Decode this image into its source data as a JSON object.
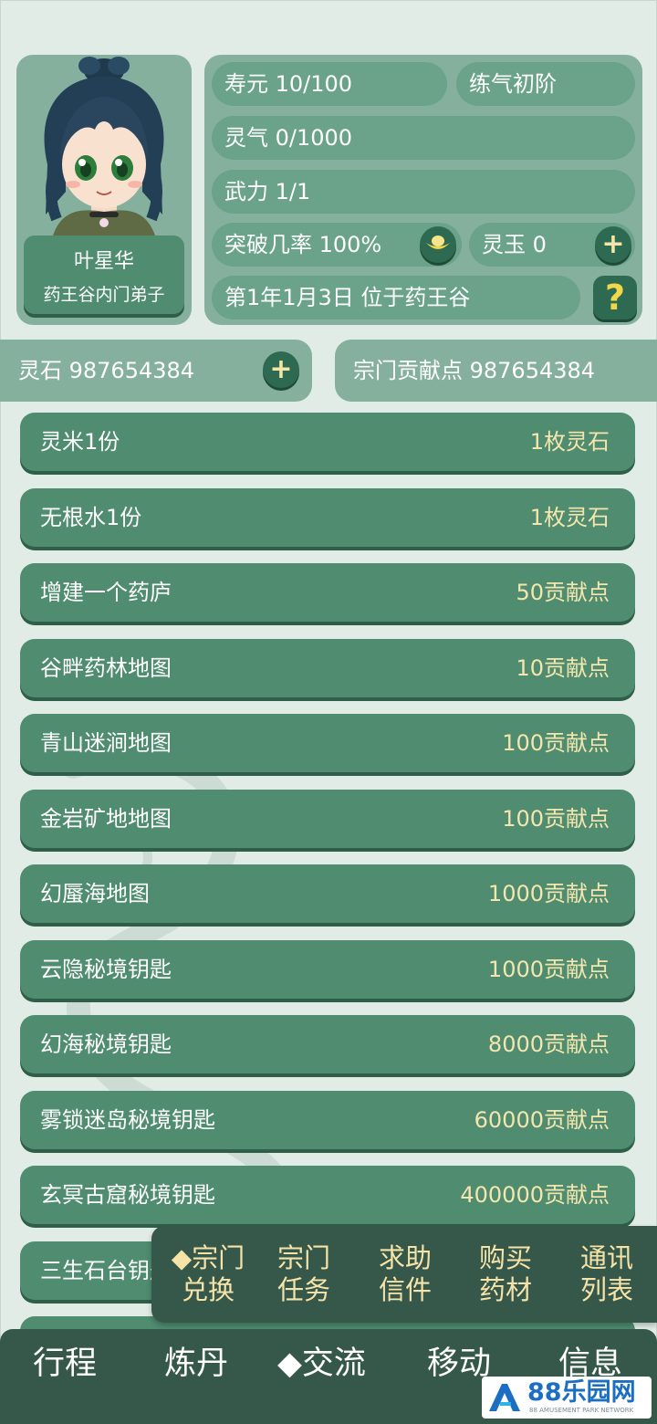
{
  "character": {
    "name": "叶星华",
    "title": "药王谷内门弟子"
  },
  "stats": {
    "lifespan": "寿元 10/100",
    "realm": "练气初阶",
    "spirit_qi": "灵气 0/1000",
    "force": "武力 1/1",
    "breakthrough": "突破几率 100%",
    "spirit_jade": "灵玉 0",
    "date_location": "第1年1月3日 位于药王谷"
  },
  "currency": {
    "spirit_stone": "灵石 987654384",
    "sect_contribution": "宗门贡献点 987654384"
  },
  "items": [
    {
      "label": "灵米1份",
      "price": "1枚灵石"
    },
    {
      "label": "无根水1份",
      "price": "1枚灵石"
    },
    {
      "label": "增建一个药庐",
      "price": "50贡献点"
    },
    {
      "label": "谷畔药林地图",
      "price": "10贡献点"
    },
    {
      "label": "青山迷涧地图",
      "price": "100贡献点"
    },
    {
      "label": "金岩矿地地图",
      "price": "100贡献点"
    },
    {
      "label": "幻蜃海地图",
      "price": "1000贡献点"
    },
    {
      "label": "云隐秘境钥匙",
      "price": "1000贡献点"
    },
    {
      "label": "幻海秘境钥匙",
      "price": "8000贡献点"
    },
    {
      "label": "雾锁迷岛秘境钥匙",
      "price": "60000贡献点"
    },
    {
      "label": "玄冥古窟秘境钥匙",
      "price": "400000贡献点"
    },
    {
      "label": "三生石台钥匙",
      "price": ""
    }
  ],
  "submenu": [
    {
      "line1": "◆宗门",
      "line2": "兑换"
    },
    {
      "line1": "宗门",
      "line2": "任务"
    },
    {
      "line1": "求助",
      "line2": "信件"
    },
    {
      "line1": "购买",
      "line2": "药材"
    },
    {
      "line1": "通讯",
      "line2": "列表"
    }
  ],
  "bottom_nav": [
    "行程",
    "炼丹",
    "◆交流",
    "移动",
    "信息"
  ],
  "watermark": {
    "text": "88乐园网",
    "subtext": "88 AMUSEMENT PARK NETWORK"
  },
  "icons": {
    "breakthrough_button": "ingot-icon",
    "plus_button": "plus-icon",
    "help_button": "question-icon"
  },
  "colors": {
    "background": "#e2ece6",
    "panel": "#85b09d",
    "button": "#4f8c70",
    "dark_button": "#2e6a51",
    "price_text": "#f4e6ae",
    "menu_bg": "#35584b",
    "menu_text": "#f6e3a8"
  }
}
